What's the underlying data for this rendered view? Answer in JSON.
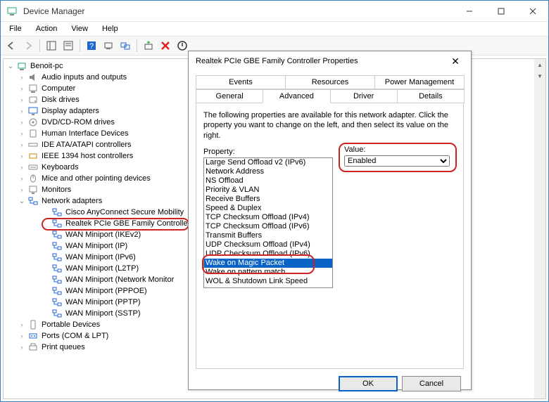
{
  "window": {
    "title": "Device Manager",
    "menus": [
      "File",
      "Action",
      "View",
      "Help"
    ]
  },
  "tree": {
    "root": "Benoit-pc",
    "nodes": [
      {
        "label": "Audio inputs and outputs",
        "icon": "speaker"
      },
      {
        "label": "Computer",
        "icon": "computer"
      },
      {
        "label": "Disk drives",
        "icon": "disk"
      },
      {
        "label": "Display adapters",
        "icon": "display"
      },
      {
        "label": "DVD/CD-ROM drives",
        "icon": "cd"
      },
      {
        "label": "Human Interface Devices",
        "icon": "hid"
      },
      {
        "label": "IDE ATA/ATAPI controllers",
        "icon": "ide"
      },
      {
        "label": "IEEE 1394 host controllers",
        "icon": "ieee"
      },
      {
        "label": "Keyboards",
        "icon": "keyboard"
      },
      {
        "label": "Mice and other pointing devices",
        "icon": "mouse"
      },
      {
        "label": "Monitors",
        "icon": "monitor"
      },
      {
        "label": "Network adapters",
        "icon": "network",
        "expanded": true,
        "children": [
          {
            "label": "Cisco AnyConnect Secure Mobility",
            "icon": "net"
          },
          {
            "label": "Realtek PCIe GBE Family Controller",
            "icon": "net",
            "highlighted": true
          },
          {
            "label": "WAN Miniport (IKEv2)",
            "icon": "net"
          },
          {
            "label": "WAN Miniport (IP)",
            "icon": "net"
          },
          {
            "label": "WAN Miniport (IPv6)",
            "icon": "net"
          },
          {
            "label": "WAN Miniport (L2TP)",
            "icon": "net"
          },
          {
            "label": "WAN Miniport (Network Monitor",
            "icon": "net"
          },
          {
            "label": "WAN Miniport (PPPOE)",
            "icon": "net"
          },
          {
            "label": "WAN Miniport (PPTP)",
            "icon": "net"
          },
          {
            "label": "WAN Miniport (SSTP)",
            "icon": "net"
          }
        ]
      },
      {
        "label": "Portable Devices",
        "icon": "portable"
      },
      {
        "label": "Ports (COM & LPT)",
        "icon": "ports"
      },
      {
        "label": "Print queues",
        "icon": "printer"
      }
    ]
  },
  "dialog": {
    "title": "Realtek PCIe GBE Family Controller Properties",
    "tabs_row1": [
      "Events",
      "Resources",
      "Power Management"
    ],
    "tabs_row2": [
      "General",
      "Advanced",
      "Driver",
      "Details"
    ],
    "active_tab": "Advanced",
    "description": "The following properties are available for this network adapter. Click the property you want to change on the left, and then select its value on the right.",
    "property_label": "Property:",
    "value_label": "Value:",
    "properties": [
      "Large Send Offload v2 (IPv6)",
      "Network Address",
      "NS Offload",
      "Priority & VLAN",
      "Receive Buffers",
      "Speed & Duplex",
      "TCP Checksum Offload (IPv4)",
      "TCP Checksum Offload (IPv6)",
      "Transmit Buffers",
      "UDP Checksum Offload (IPv4)",
      "UDP Checksum Offload (IPv6)",
      "Wake on Magic Packet",
      "Wake on pattern match",
      "WOL & Shutdown Link Speed"
    ],
    "selected_property": "Wake on Magic Packet",
    "value": "Enabled",
    "ok": "OK",
    "cancel": "Cancel"
  }
}
